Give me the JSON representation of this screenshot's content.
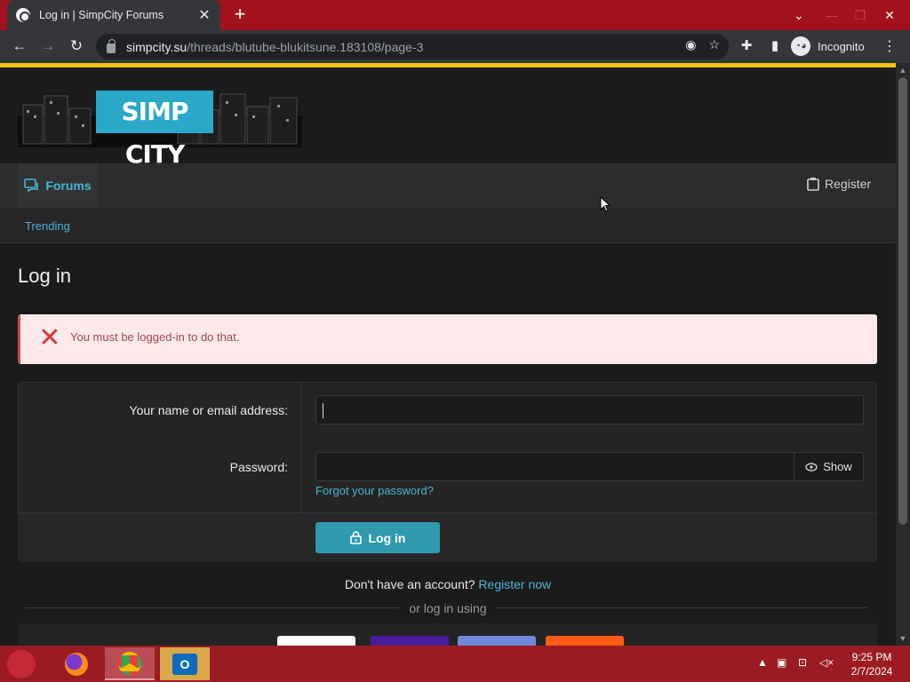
{
  "browser": {
    "tab_title": "Log in | SimpCity Forums",
    "tab_close": "✕",
    "new_tab": "+",
    "url_host": "simpcity.su",
    "url_path": "/threads/blutube-blukitsune.183108/page-3",
    "incognito_label": "Incognito",
    "window_min": "—",
    "window_max": "❐",
    "window_close": "✕",
    "tab_dropdown": "⌄"
  },
  "site": {
    "logo_text": "SIMP CITY",
    "nav": {
      "forums": "Forums",
      "register": "Register",
      "trending": "Trending"
    }
  },
  "page": {
    "title": "Log in",
    "alert": {
      "icon": "✕",
      "message": "You must be logged-in to do that."
    },
    "form": {
      "username_label": "Your name or email address:",
      "username_value": "",
      "password_label": "Password:",
      "password_value": "",
      "show_label": "Show",
      "forgot_link": "Forgot your password?",
      "login_button": "Log in"
    },
    "no_account_text": "Don't have an account?",
    "register_now": "Register now",
    "or_login_using": "or log in using"
  },
  "taskbar": {
    "time": "9:25 PM",
    "date": "2/7/2024",
    "apps": [
      "firefox-icon",
      "chrome-icon",
      "outlook-icon"
    ]
  },
  "colors": {
    "accent_blue": "#47b5d6",
    "button_teal": "#2f99ae",
    "alert_bg": "#fde9ea",
    "alert_red": "#d33a3a",
    "chrome_red": "#a3111c",
    "accent_yellow": "#f2c114"
  }
}
